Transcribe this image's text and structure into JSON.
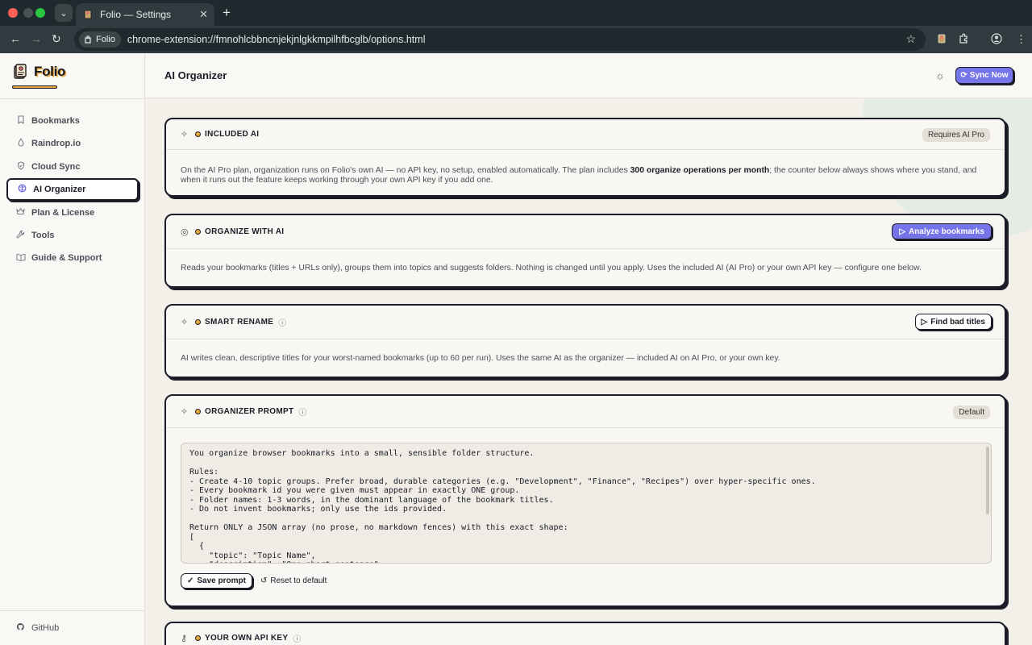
{
  "browser": {
    "tab_title": "Folio — Settings",
    "tab_close": "✕",
    "new_tab": "+",
    "chip_label": "Folio",
    "url": "chrome-extension://fmnohlcbbncnjekjnlgkkmpilhfbcglb/options.html"
  },
  "sidebar": {
    "brand": "Folio",
    "items": [
      {
        "label": "Bookmarks",
        "icon": "bookmark-icon"
      },
      {
        "label": "Raindrop.io",
        "icon": "drop-icon"
      },
      {
        "label": "Cloud Sync",
        "icon": "shield-icon"
      },
      {
        "label": "AI Organizer",
        "icon": "brain-icon"
      },
      {
        "label": "Plan & License",
        "icon": "crown-icon"
      },
      {
        "label": "Tools",
        "icon": "wrench-icon"
      },
      {
        "label": "Guide & Support",
        "icon": "book-icon"
      }
    ],
    "active_item": "AI Organizer",
    "github": "GitHub"
  },
  "header": {
    "title": "AI Organizer",
    "sync_label": "Sync Now"
  },
  "cards": {
    "included": {
      "title": "INCLUDED AI",
      "badge": "Requires AI Pro",
      "body_pre": "On the AI Pro plan, organization runs on Folio's own AI — no API key, no setup, enabled automatically. The plan includes ",
      "body_bold": "300 organize operations per month",
      "body_post": "; the counter below always shows where you stand, and when it runs out the feature keeps working through your own API key if you add one."
    },
    "organize": {
      "title": "ORGANIZE WITH AI",
      "button": "Analyze bookmarks",
      "body": "Reads your bookmarks (titles + URLs only), groups them into topics and suggests folders. Nothing is changed until you apply. Uses the included AI (AI Pro) or your own API key — configure one below."
    },
    "rename": {
      "title": "SMART RENAME",
      "button": "Find bad titles",
      "body": "AI writes clean, descriptive titles for your worst-named bookmarks (up to 60 per run). Uses the same AI as the organizer — included AI on AI Pro, or your own key."
    },
    "prompt": {
      "title": "ORGANIZER PROMPT",
      "badge": "Default",
      "text": "You organize browser bookmarks into a small, sensible folder structure.\n\nRules:\n- Create 4-10 topic groups. Prefer broad, durable categories (e.g. \"Development\", \"Finance\", \"Recipes\") over hyper-specific ones.\n- Every bookmark id you were given must appear in exactly ONE group.\n- Folder names: 1-3 words, in the dominant language of the bookmark titles.\n- Do not invent bookmarks; only use the ids provided.\n\nReturn ONLY a JSON array (no prose, no markdown fences) with this exact shape:\n[\n  {\n    \"topic\": \"Topic Name\",\n    \"description\": \"One short sentence\",",
      "save": "Save prompt",
      "reset": "Reset to default"
    },
    "apikey": {
      "title": "YOUR OWN API KEY"
    }
  },
  "colors": {
    "accent": "#7574e8",
    "dot": "#e9a83a",
    "ink": "#1c1c28"
  }
}
